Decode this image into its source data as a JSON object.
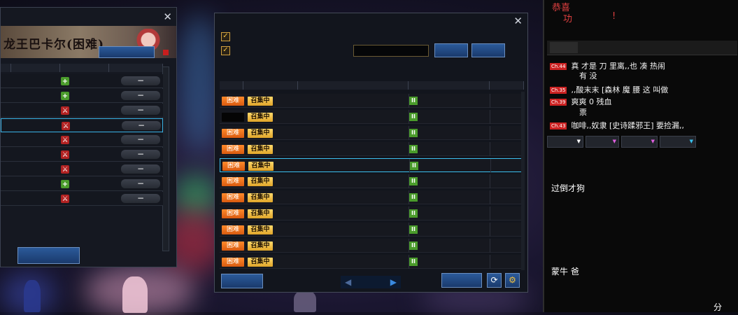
{
  "left_panel": {
    "close_icon": "close-icon",
    "title": "龙王巴卡尔(困难)",
    "rows": [
      {
        "icon": "plus",
        "name": "",
        "level": "",
        "action": "−",
        "selected": false
      },
      {
        "icon": "plus",
        "name": "",
        "level": "",
        "action": "−",
        "selected": false
      },
      {
        "icon": "sword",
        "name": "",
        "level": "",
        "action": "−",
        "selected": false
      },
      {
        "icon": "sword",
        "name": "",
        "level": "",
        "action": "−",
        "selected": true
      },
      {
        "icon": "sword",
        "name": "",
        "level": "",
        "action": "−",
        "selected": false
      },
      {
        "icon": "sword",
        "name": "",
        "level": "",
        "action": "−",
        "selected": false
      },
      {
        "icon": "sword",
        "name": "",
        "level": "",
        "action": "−",
        "selected": false
      },
      {
        "icon": "plus",
        "name": "",
        "level": "",
        "action": "−",
        "selected": false
      },
      {
        "icon": "sword",
        "name": "",
        "level": "",
        "action": "−",
        "selected": false
      }
    ],
    "bottom_button": ""
  },
  "middle_panel": {
    "title": "",
    "close_icon": "close-icon",
    "checkbox_1": {
      "checked": true,
      "label": ""
    },
    "checkbox_2": {
      "checked": true,
      "label": ""
    },
    "search_placeholder": "",
    "search_button": "",
    "refresh_button": "",
    "columns": [
      "",
      "",
      "",
      "",
      ""
    ],
    "rows": [
      {
        "difficulty": "困难",
        "status": "召集中",
        "dark": false,
        "selected": false
      },
      {
        "difficulty": "",
        "status": "召集中",
        "dark": true,
        "selected": false
      },
      {
        "difficulty": "困难",
        "status": "召集中",
        "dark": false,
        "selected": false
      },
      {
        "difficulty": "困难",
        "status": "召集中",
        "dark": false,
        "selected": false
      },
      {
        "difficulty": "困难",
        "status": "召集中",
        "dark": false,
        "selected": true
      },
      {
        "difficulty": "困难",
        "status": "召集中",
        "dark": false,
        "selected": false
      },
      {
        "difficulty": "困难",
        "status": "召集中",
        "dark": false,
        "selected": false
      },
      {
        "difficulty": "困难",
        "status": "召集中",
        "dark": false,
        "selected": false
      },
      {
        "difficulty": "困难",
        "status": "召集中",
        "dark": false,
        "selected": false
      },
      {
        "difficulty": "困难",
        "status": "召集中",
        "dark": false,
        "selected": false
      },
      {
        "difficulty": "困难",
        "status": "召集中",
        "dark": false,
        "selected": false
      }
    ],
    "bottom_left_button": "",
    "bottom_right_button": "",
    "refresh_icon": "refresh-icon",
    "settings_icon": "gear-icon"
  },
  "right_panel": {
    "notice_line1": "恭喜",
    "notice_line2": "功",
    "notice_mark": "!",
    "tab_label": "",
    "chat": [
      {
        "channel": "Ch.44",
        "text": "真  才是  刀   里离,,也  凑  热闹"
      },
      {
        "channel": "",
        "text": "有        没"
      },
      {
        "channel": "Ch.35",
        "text": ",,酸末末  [森林  魔  腰  这     叫做"
      },
      {
        "channel": "Ch.39",
        "text": "爽爽                        0  残血"
      },
      {
        "channel": "",
        "text": "票"
      },
      {
        "channel": "Ch.43",
        "text": "咖啡,,奴隶  [史诗蹂邪王]      要捡漏,,"
      }
    ],
    "filters": [
      "",
      "",
      "",
      ""
    ],
    "chat2": [
      {
        "text": "过倒才狗"
      },
      {
        "text": "蒙牛  爸"
      },
      {
        "text": "分"
      }
    ]
  }
}
